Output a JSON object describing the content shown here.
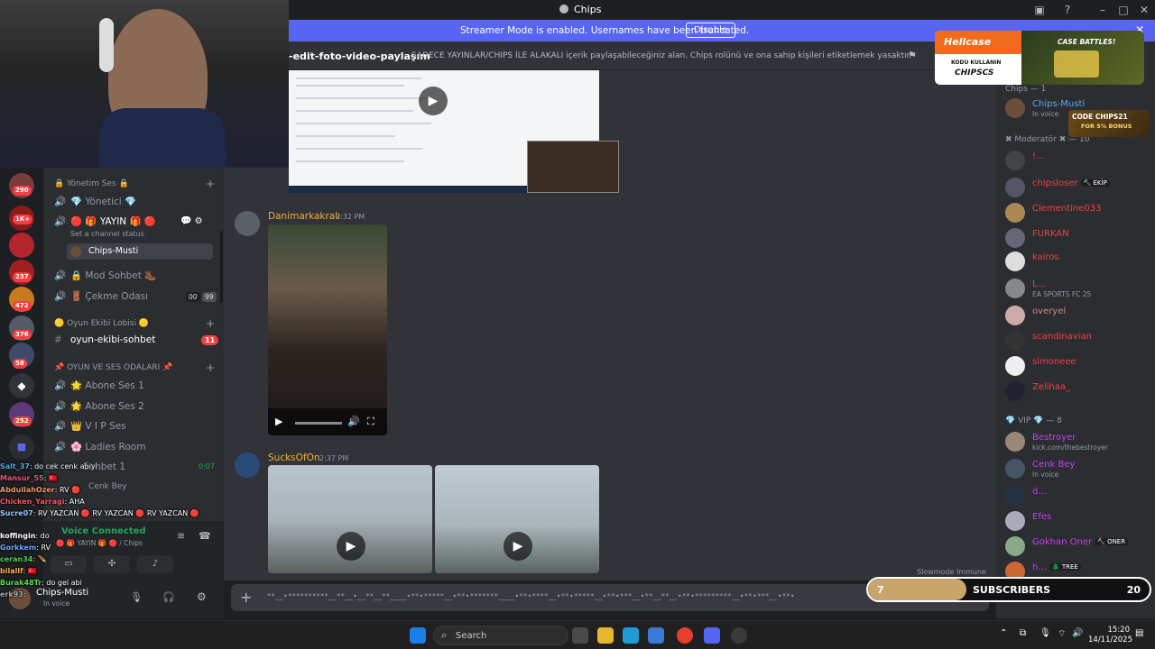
{
  "window": {
    "title": "Chips"
  },
  "banner": {
    "message": "Streamer Mode is enabled. Usernames have been truncated.",
    "disable_label": "Disable"
  },
  "topic": {
    "channel": "-edit-foto-video-paylaşım",
    "description": "SADECE YAYINLAR/CHIPS İLE ALAKALI içerik paylaşabileceğiniz alan. Chips rolünü ve ona sahip kişileri etiketlemek yasaktır."
  },
  "servers": [
    {
      "badge": "290",
      "color": "#7a3b3b"
    },
    {
      "badge": "1K+",
      "color": "#8b1a1a"
    },
    {
      "badge": "",
      "color": "#b3242d"
    },
    {
      "badge": "237",
      "color": "#a02020"
    },
    {
      "badge": "472",
      "color": "#c77a1f"
    },
    {
      "badge": "376",
      "color": "#555a63"
    },
    {
      "badge": "58",
      "color": "#3f4a6b"
    },
    {
      "badge": "",
      "color": "#313338"
    },
    {
      "badge": "252",
      "color": "#5c3a7a"
    }
  ],
  "sidebar": {
    "cat1": "🔒 Yönetim Ses 🔒",
    "ch_yonetici": "💎 Yönetici 💎",
    "ch_yayin": "🔴 🎁 YAYIN 🎁 🔴",
    "ch_yayin_status": "Set a channel status",
    "ch_yayin_user": "Chips-Musti",
    "ch_mod": "🔒 Mod Sohbet 🥾",
    "ch_cekme": "🚪 Çekme Odası",
    "cekme_count_a": "00",
    "cekme_count_b": "99",
    "cat2": "🟡 Oyun Ekibi Lobisi 🟡",
    "ch_oyun": "oyun-ekibi-sohbet",
    "oyun_badge": "11",
    "cat3": "📌 OYUN VE SES ODALARI 📌",
    "ch_abone1": "🌟 Abone Ses 1",
    "ch_abone2": "🌟 Abone Ses 2",
    "ch_vip": "👑 V I P Ses",
    "ch_ladies": "🌸 Ladies Room",
    "ch_sohbet1": "Sohbet 1",
    "sohbet_time": "0:07",
    "ch_cenk": "Cenk Bey"
  },
  "voice": {
    "status": "Voice Connected",
    "location": "🔴 🎁 YAYIN 🎁 🔴 / Chips"
  },
  "userbar": {
    "name": "Chips-Musti",
    "status": "In voice"
  },
  "chat_overlay": [
    {
      "name": "Salt_37",
      "text": ": do cek cenk abiyi",
      "color": "#5ad"
    },
    {
      "name": "Mansur_55",
      "text": ": 🇹🇷",
      "color": "#e57"
    },
    {
      "name": "AbdullahOzer",
      "text": ": RV 🔴",
      "color": "#e96"
    },
    {
      "name": "Chicken_Yarragi",
      "text": ": AHA",
      "color": "#f55"
    },
    {
      "name": "Sucre07",
      "text": ": RV YAZCAN 🔴 RV YAZCAN 🔴 RV YAZCAN 🔴",
      "color": "#9cf"
    },
    {
      "name": "koffingin",
      "text": ": do",
      "color": "#fff"
    },
    {
      "name": "Gorkkem",
      "text": ": RV",
      "color": "#6af"
    },
    {
      "name": "ceran34",
      "text": ": 🪶",
      "color": "#5c5"
    },
    {
      "name": "bilallf",
      "text": ": 🇹🇷",
      "color": "#fa5"
    },
    {
      "name": "Burak48Tr",
      "text": ": do gel abi",
      "color": "#5d5"
    },
    {
      "name": "erk93",
      "text": ":",
      "color": "#aaa"
    }
  ],
  "messages": [
    {
      "author": "Danimarkakralı",
      "time": "2:32 PM"
    },
    {
      "author": "SucksOfOn",
      "time": "2:37 PM"
    }
  ],
  "input": {
    "placeholder": "**__•**********__**__•__**__**____•**•*****__•**•*******____•**•****__•**•*****__•**•***__•**__**__•**•*********__•**•***__•**•"
  },
  "slowmode": "Slowmode Immune",
  "members": {
    "group_chips": "Chips — 1",
    "group_mod": "✖ Moderatör ✖ — 10",
    "group_vip": "💎 VIP 💎 — 8",
    "list": [
      {
        "name": "Chips-Musti",
        "status": "In voice",
        "color": "#5aa9e6",
        "av": "#6b4f3a"
      },
      {
        "name": "!...",
        "status": "",
        "color": "#f23f42",
        "av": "#444"
      },
      {
        "name": "chipsloser",
        "status": "",
        "color": "#f23f42",
        "av": "#556",
        "tag": "🔨 EKİP"
      },
      {
        "name": "Clementine033",
        "status": "",
        "color": "#f23f42",
        "av": "#a85"
      },
      {
        "name": "FURKAN",
        "status": "",
        "color": "#f23f42",
        "av": "#667"
      },
      {
        "name": "kairos",
        "status": "",
        "color": "#f23f42",
        "av": "#ddd"
      },
      {
        "name": "L...",
        "status": "EA SPORTS FC 25",
        "color": "#f23f42",
        "av": "#888"
      },
      {
        "name": "overyel",
        "status": "",
        "color": "#c88",
        "av": "#caa"
      },
      {
        "name": "scandinavian",
        "status": "",
        "color": "#f23f42",
        "av": "#333"
      },
      {
        "name": "simoneee",
        "status": "",
        "color": "#f23f42",
        "av": "#eee"
      },
      {
        "name": "Zelihaa_",
        "status": "",
        "color": "#f23f42",
        "av": "#223"
      },
      {
        "name": "Bestroyer",
        "status": "kick.com/thebestroyer",
        "color": "#c83cff",
        "av": "#987"
      },
      {
        "name": "Cenk Bey",
        "status": "In voice",
        "color": "#c83cff",
        "av": "#456"
      },
      {
        "name": "d...",
        "status": "",
        "color": "#c83cff",
        "av": "#234"
      },
      {
        "name": "Efes",
        "status": "",
        "color": "#c83cff",
        "av": "#aab"
      },
      {
        "name": "Gokhan Oner",
        "status": "",
        "color": "#c83cff",
        "av": "#8a8",
        "tag": "🔨 ONER"
      },
      {
        "name": "h...",
        "status": "",
        "color": "#c83cff",
        "av": "#c63",
        "tag": "🌲 TREE"
      }
    ]
  },
  "ad": {
    "brand": "Hellcase",
    "line1": "KODU KULLANIN",
    "code": "CHIPSCS",
    "promo": "CASE BATTLES!",
    "bonus_code": "CODE CHIPS21",
    "bonus": "FOR 5% BONUS"
  },
  "subscribers": {
    "current": "7",
    "label": "SUBSCRIBERS",
    "goal": "20",
    "progress": 0.35
  },
  "taskbar": {
    "search": "Search",
    "time": "15:20",
    "date": "14/11/2025"
  }
}
